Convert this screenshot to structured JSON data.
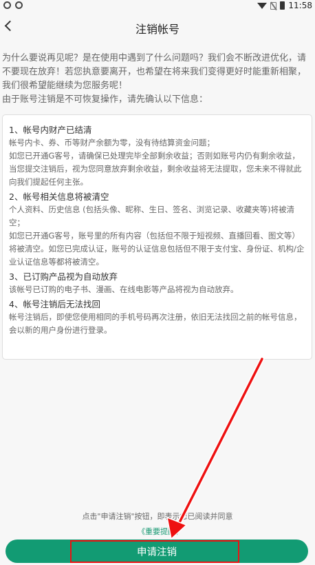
{
  "status": {
    "time": "11:58"
  },
  "header": {
    "title": "注销帐号"
  },
  "intro": [
    "为什么要说再见呢？是在使用中遇到了什么问题吗？我们会不断改进优化，请不要现在放弃！若您执意要离开，也希望在将来我们变得更好时能重新相聚，我们很希望能继续为您服务呢！",
    "由于账号注销是不可恢复操作，请先确认以下信息："
  ],
  "sections": [
    {
      "heading": "1、帐号内财产已结清",
      "paragraphs": [
        "帐号内卡、券、币等财产余额为零，没有待结算资金问题；",
        "如您已开通G客号，请确保已处理完毕全部剩余收益；否则如账号内仍有剩余收益，当您提交注销后，视为您同意放弃剩余收益，剩余收益将无法提取，您未来不得就此向我们提起任何主张。"
      ]
    },
    {
      "heading": "2、帐号相关信息将被清空",
      "paragraphs": [
        "个人资料、历史信息 (包括头像、昵称、生日、签名、浏览记录、收藏夹等)将被清空；",
        "如您已开通G客号，账号里的所有内容（包括但不限于短视频、直播回看、图文等）将被清空。如您已完成认证，账号的认证信息包括但不限于支付宝、身份证、机构/企业认证信息等都将被清空。"
      ]
    },
    {
      "heading": "3、已订购产品视为自动放弃",
      "paragraphs": [
        "该帐号已订购的电子书、漫画、在线电影等产品将视为自动放弃。"
      ]
    },
    {
      "heading": "4、帐号注销后无法找回",
      "paragraphs": [
        "帐号注销后，即使您使用相同的手机号码再次注册，依旧无法找回之前的帐号信息，会以新的用户身份进行登录。"
      ]
    }
  ],
  "footer": {
    "notice": "点击\"申请注销\"按钮，即表示您已阅读并同意",
    "link": "《重要提醒》",
    "button": "申请注销"
  },
  "colors": {
    "accent": "#129b73",
    "highlight": "#e11111"
  }
}
